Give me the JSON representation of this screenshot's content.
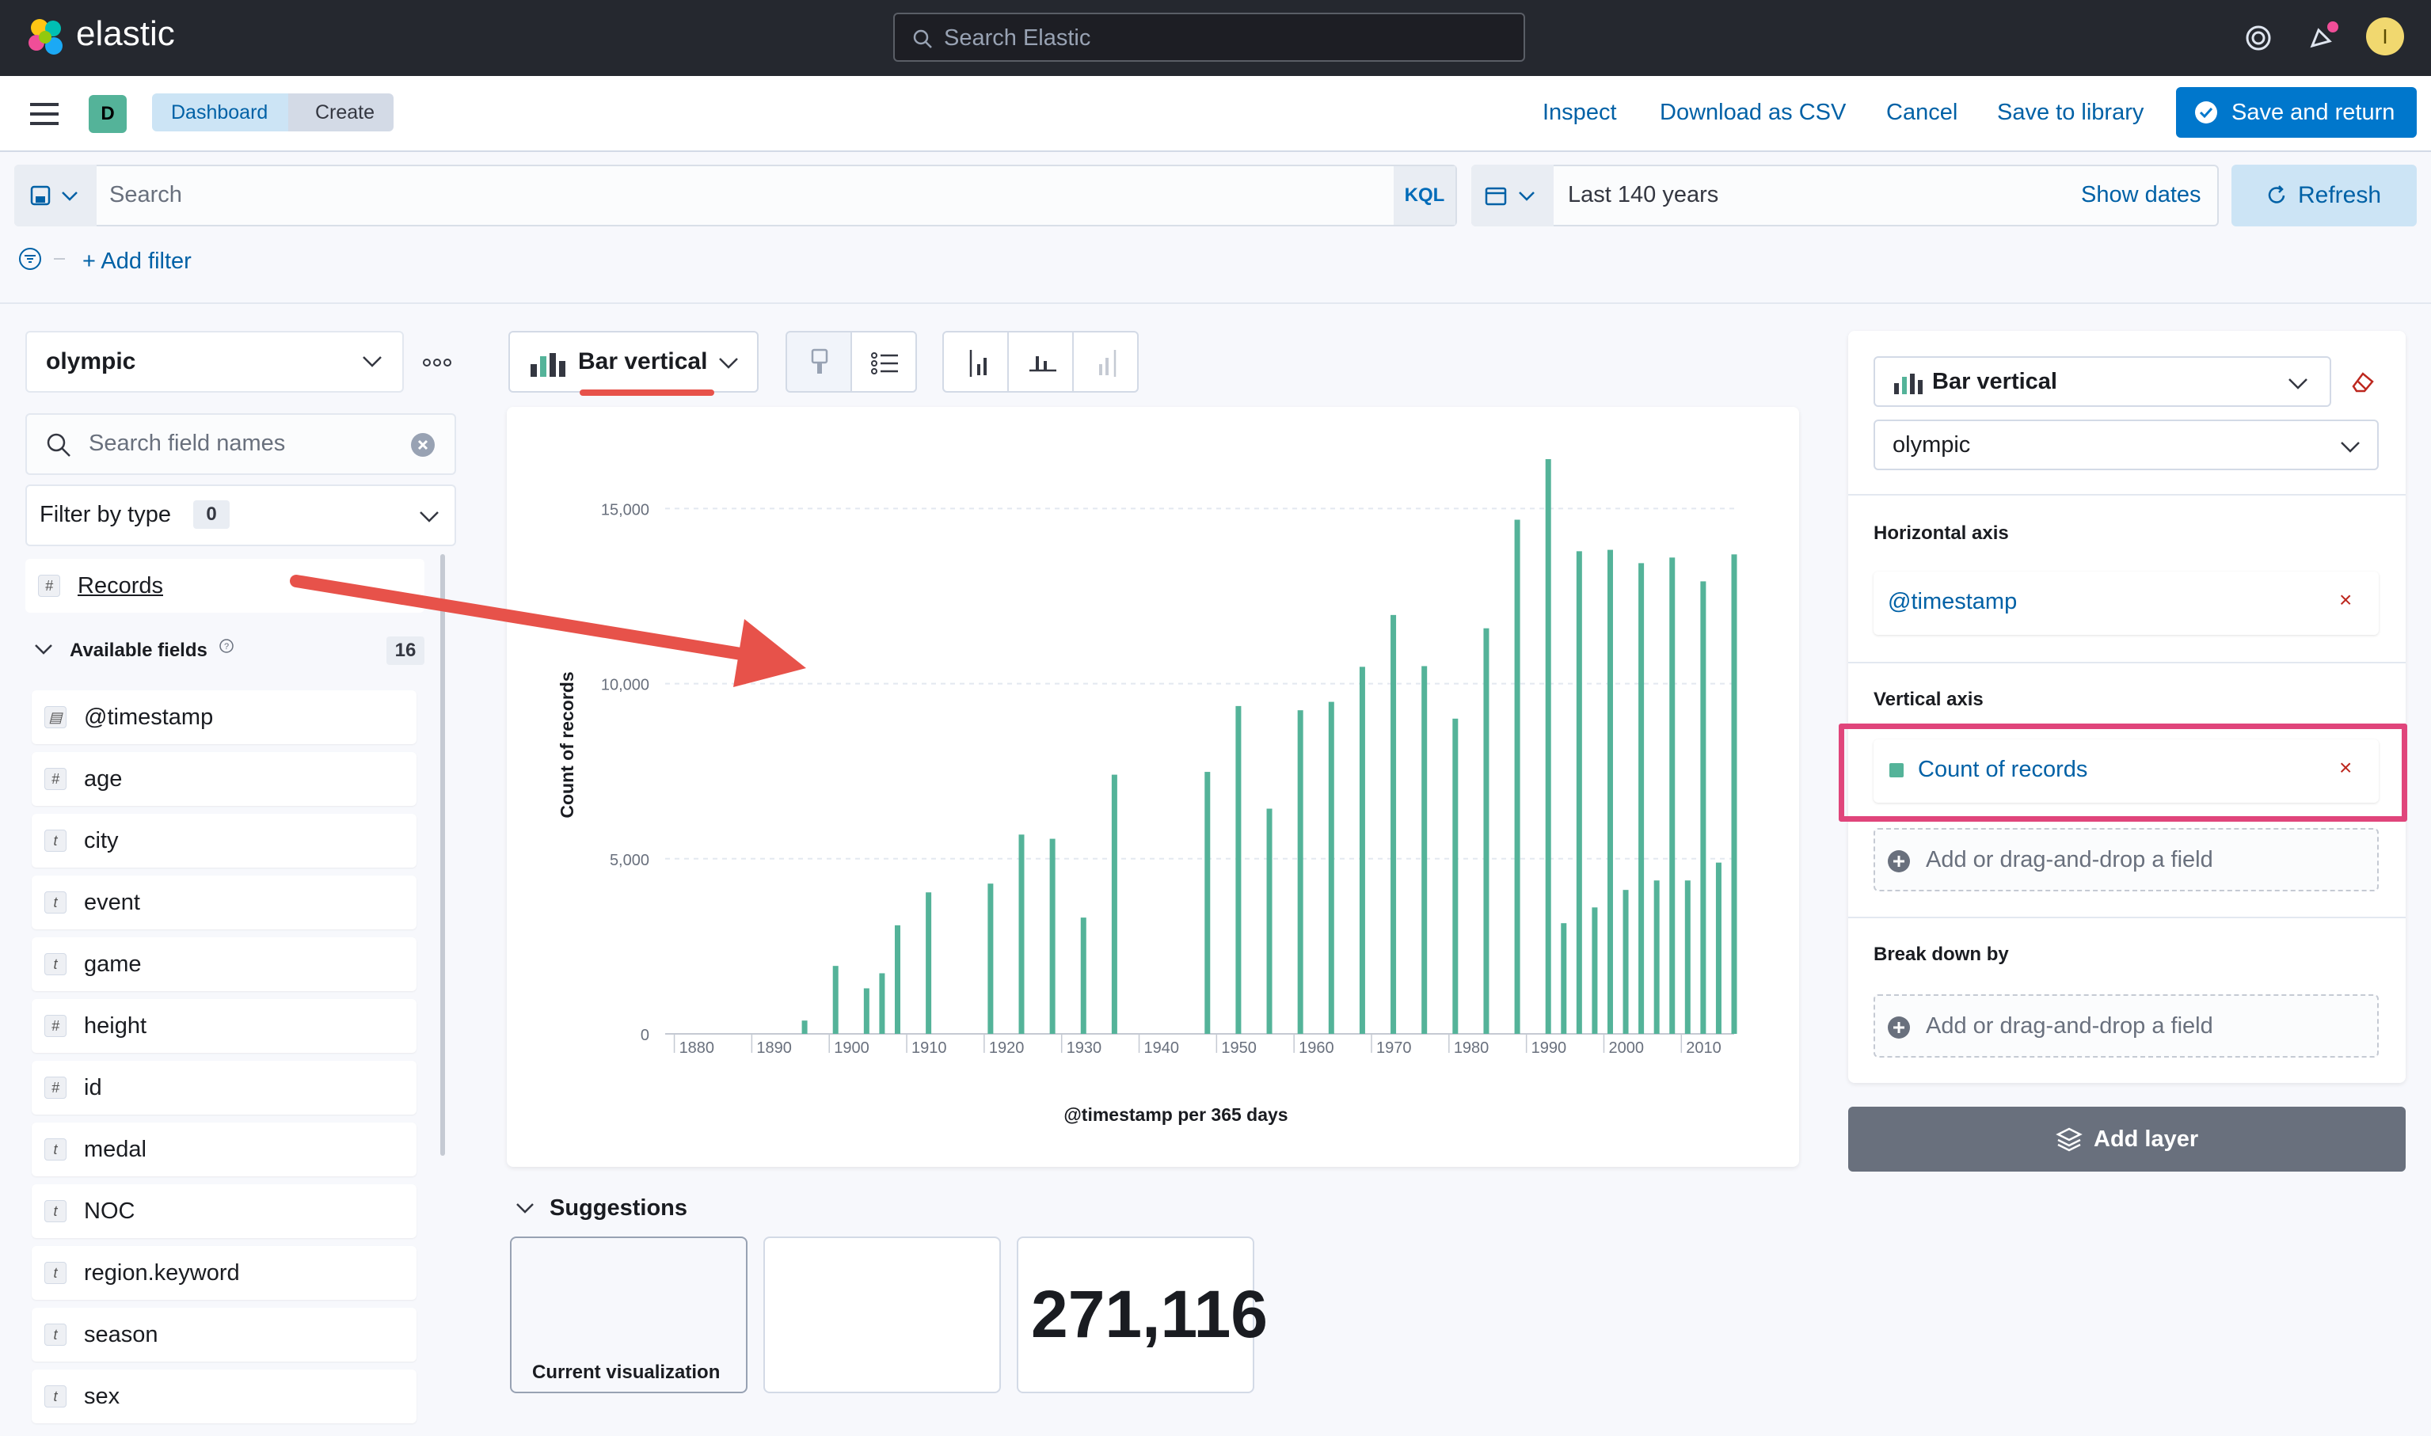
{
  "app": {
    "brand": "elastic",
    "search_placeholder": "Search Elastic",
    "avatar_initial": "I"
  },
  "nav": {
    "space_badge": "D",
    "breadcrumbs": [
      "Dashboard",
      "Create"
    ],
    "actions": [
      "Inspect",
      "Download as CSV",
      "Cancel",
      "Save to library"
    ],
    "primary_action": "Save and return"
  },
  "query": {
    "placeholder": "Search",
    "language": "KQL",
    "time_range": "Last 140 years",
    "show_dates": "Show dates",
    "refresh": "Refresh",
    "add_filter": "+ Add filter"
  },
  "sidebar": {
    "index_pattern": "olympic",
    "field_search_placeholder": "Search field names",
    "filter_by_type": "Filter by type",
    "filter_count": "0",
    "records_field": "Records",
    "available_label": "Available fields",
    "available_count": "16",
    "fields": [
      {
        "name": "@timestamp",
        "type": "date"
      },
      {
        "name": "age",
        "type": "#"
      },
      {
        "name": "city",
        "type": "t"
      },
      {
        "name": "event",
        "type": "t"
      },
      {
        "name": "game",
        "type": "t"
      },
      {
        "name": "height",
        "type": "#"
      },
      {
        "name": "id",
        "type": "#"
      },
      {
        "name": "medal",
        "type": "t"
      },
      {
        "name": "NOC",
        "type": "t"
      },
      {
        "name": "region.keyword",
        "type": "t"
      },
      {
        "name": "season",
        "type": "t"
      },
      {
        "name": "sex",
        "type": "t"
      }
    ]
  },
  "workspace": {
    "vis_type": "Bar vertical",
    "suggestions_label": "Suggestions",
    "current_viz_label": "Current visualization",
    "metric_value": "271,116"
  },
  "chart_data": {
    "type": "bar",
    "title": "",
    "xlabel": "@timestamp per 365 days",
    "ylabel": "Count of records",
    "ylim": [
      0,
      16500
    ],
    "xlim": [
      1878,
      2016
    ],
    "x_ticks": [
      "1880",
      "1890",
      "1900",
      "1910",
      "1920",
      "1930",
      "1940",
      "1950",
      "1960",
      "1970",
      "1980",
      "1990",
      "2000",
      "2010"
    ],
    "y_ticks": [
      "0",
      "5,000",
      "10,000",
      "15,000"
    ],
    "color": "#54b399",
    "x": [
      1896,
      1900,
      1904,
      1906,
      1908,
      1912,
      1920,
      1924,
      1928,
      1932,
      1936,
      1948,
      1952,
      1956,
      1960,
      1964,
      1968,
      1972,
      1976,
      1980,
      1984,
      1988,
      1992,
      1994,
      1996,
      1998,
      2000,
      2002,
      2004,
      2006,
      2008,
      2010,
      2012,
      2014,
      2016
    ],
    "values": [
      380,
      1940,
      1300,
      1730,
      3100,
      4040,
      4290,
      5690,
      5570,
      3320,
      7400,
      7480,
      9360,
      6430,
      9240,
      9480,
      10480,
      11960,
      10500,
      9000,
      11580,
      14680,
      16410,
      3160,
      13780,
      3610,
      13820,
      4110,
      13440,
      4380,
      13600,
      4380,
      12920,
      4890,
      13690
    ]
  },
  "config": {
    "vis_type": "Bar vertical",
    "index_pattern": "olympic",
    "horizontal_axis_label": "Horizontal axis",
    "horizontal_field": "@timestamp",
    "vertical_axis_label": "Vertical axis",
    "vertical_field": "Count of records",
    "add_field_placeholder": "Add or drag-and-drop a field",
    "breakdown_label": "Break down by",
    "add_layer": "Add layer"
  },
  "colors": {
    "accent": "#0077cc",
    "series": "#54b399",
    "highlight": "#e0457b",
    "annotation_arrow": "#e7524a"
  }
}
